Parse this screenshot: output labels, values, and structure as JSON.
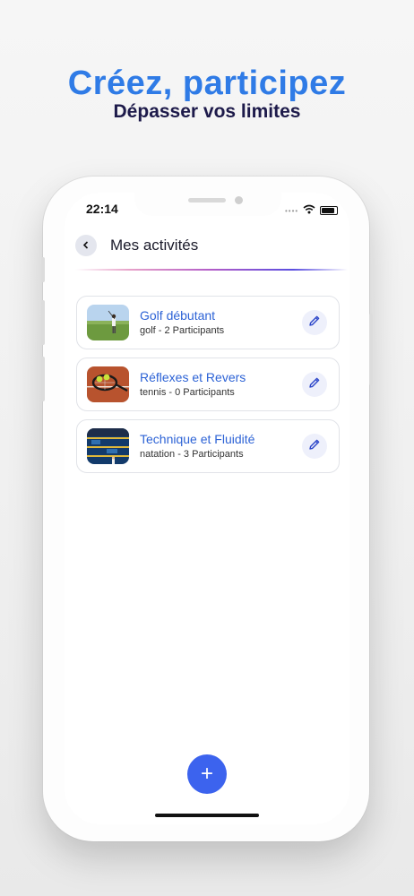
{
  "promo": {
    "headline": "Créez, participez",
    "subheadline": "Dépasser vos limites"
  },
  "status_bar": {
    "time": "22:14",
    "icons": [
      "signal-dots-icon",
      "wifi-icon",
      "battery-icon"
    ]
  },
  "header": {
    "title": "Mes activités",
    "back_icon": "chevron-left-icon"
  },
  "activities": [
    {
      "title": "Golf débutant",
      "subtitle": "golf - 2 Participants",
      "image": "golfer-photo"
    },
    {
      "title": "Réflexes et Revers",
      "subtitle": "tennis - 0 Participants",
      "image": "tennis-racket-photo"
    },
    {
      "title": "Technique et Fluidité",
      "subtitle": "natation - 3 Participants",
      "image": "swimming-pool-photo"
    }
  ],
  "fab": {
    "label": "+"
  },
  "colors": {
    "accent": "#3c63ee",
    "headline": "#2f7be6",
    "subheadline": "#1d1a4a",
    "card_title": "#2d63d6"
  }
}
